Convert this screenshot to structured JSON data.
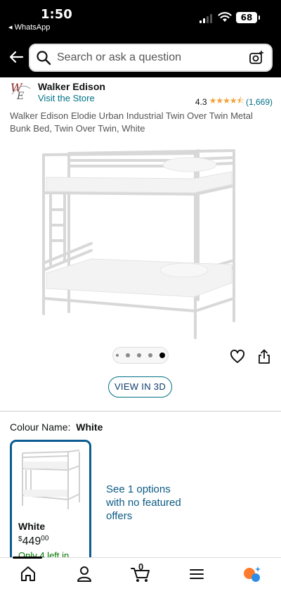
{
  "status_bar": {
    "time": "1:50",
    "back_app": "◂ WhatsApp",
    "battery": "68"
  },
  "search": {
    "placeholder": "Search or ask a question"
  },
  "store": {
    "brand": "Walker Edison",
    "visit": "Visit the Store",
    "rating": "4.3",
    "rating_count": "(1,669)",
    "stars_filled": 4.3
  },
  "product": {
    "title": "Walker Edison Elodie Urban Industrial Twin Over Twin Metal Bunk Bed, Twin Over Twin, White",
    "image_dots_total": 5,
    "image_dots_active": 5
  },
  "actions": {
    "view_3d": "VIEW IN 3D"
  },
  "colour": {
    "label": "Colour Name:",
    "value": "White"
  },
  "variant": {
    "name": "White",
    "currency": "$",
    "price_whole": "449",
    "price_fraction": "00",
    "stock": "Only 4 left in"
  },
  "offers": {
    "text": "See 1 options with no featured offers"
  },
  "nav": {
    "cart_count": "0"
  },
  "colors": {
    "accent_link": "#007185",
    "star": "#f2a33a",
    "stock_green": "#007600",
    "selected_border": "#0a5c91"
  }
}
